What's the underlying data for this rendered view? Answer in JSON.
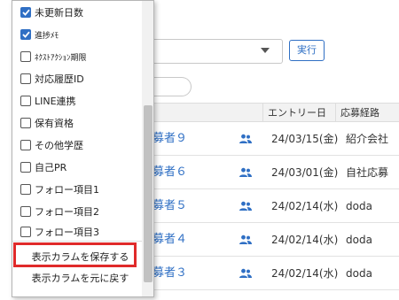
{
  "toolbar": {
    "run_label": "実行"
  },
  "table": {
    "headers": [
      "エントリー日",
      "応募経路"
    ],
    "rows": [
      {
        "name": "募者９",
        "date": "24/03/15(金)",
        "route": "紹介会社"
      },
      {
        "name": "募者６",
        "date": "24/03/01(金)",
        "route": "自社応募"
      },
      {
        "name": "募者５",
        "date": "24/02/14(水)",
        "route": "doda"
      },
      {
        "name": "募者４",
        "date": "24/02/14(水)",
        "route": "doda"
      },
      {
        "name": "募者３",
        "date": "24/02/14(水)",
        "route": "doda"
      }
    ]
  },
  "column_menu": {
    "options": [
      {
        "label": "未更新日数",
        "checked": true
      },
      {
        "label": "進捗ﾒﾓ",
        "checked": true
      },
      {
        "label": "ﾈｸｽﾄｱｸｼｮﾝ期限",
        "checked": false
      },
      {
        "label": "対応履歴ID",
        "checked": false
      },
      {
        "label": "LINE連携",
        "checked": false
      },
      {
        "label": "保有資格",
        "checked": false
      },
      {
        "label": "その他学歴",
        "checked": false
      },
      {
        "label": "自己PR",
        "checked": false
      },
      {
        "label": "フォロー項目1",
        "checked": false
      },
      {
        "label": "フォロー項目2",
        "checked": false
      },
      {
        "label": "フォロー項目3",
        "checked": false
      }
    ],
    "save_label": "表示カラムを保存する",
    "reset_label": "表示カラムを元に戻す"
  },
  "colors": {
    "accent": "#2f6fc4",
    "highlight": "#e02a2a"
  }
}
